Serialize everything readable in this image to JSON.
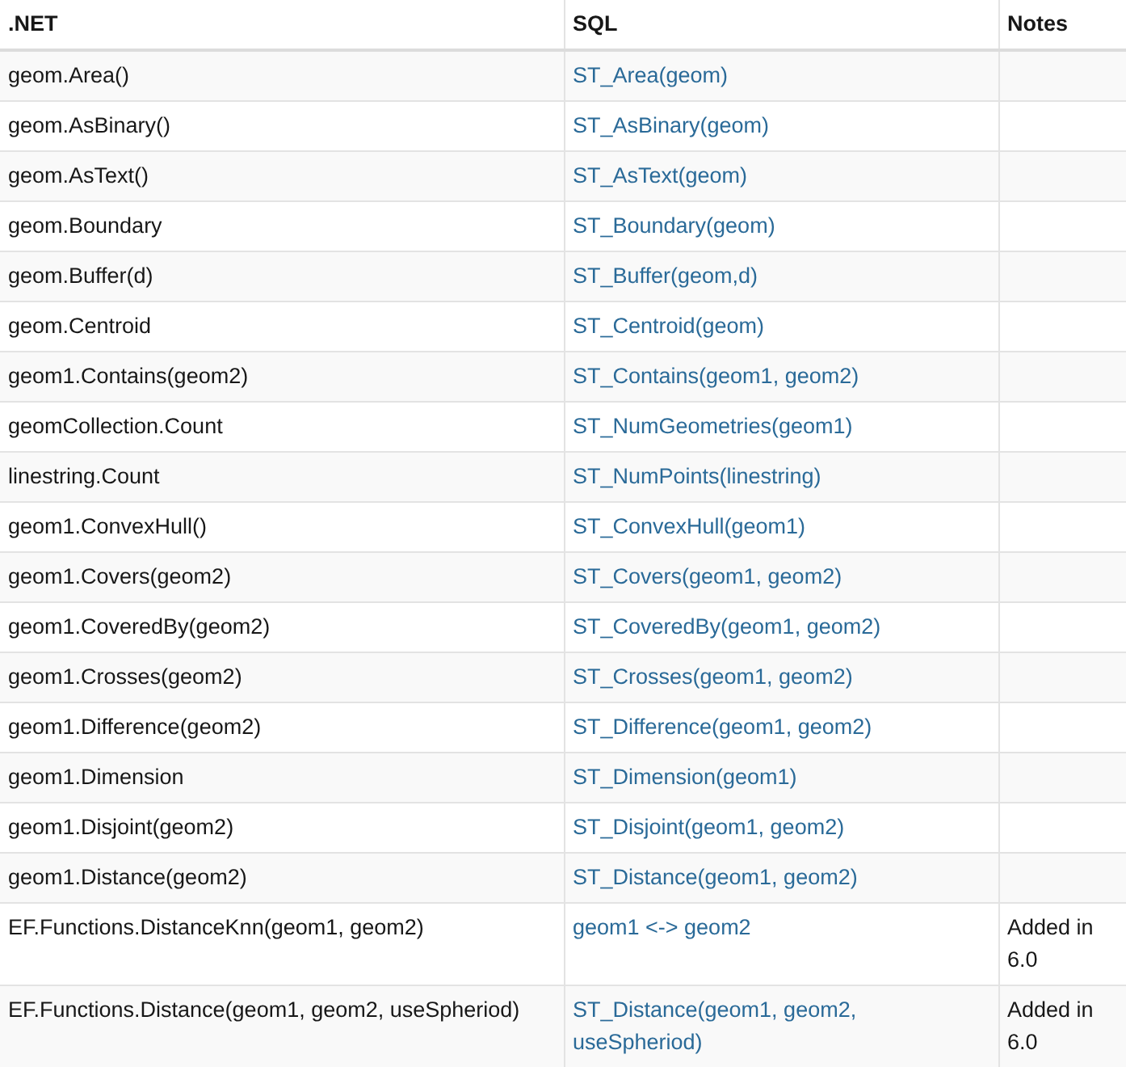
{
  "table": {
    "columns": [
      ".NET",
      "SQL",
      "Notes"
    ],
    "rows": [
      {
        "net": "geom.Area()",
        "sql": "ST_Area(geom)"
      },
      {
        "net": "geom.AsBinary()",
        "sql": "ST_AsBinary(geom)"
      },
      {
        "net": "geom.AsText()",
        "sql": "ST_AsText(geom)"
      },
      {
        "net": "geom.Boundary",
        "sql": "ST_Boundary(geom)"
      },
      {
        "net": "geom.Buffer(d)",
        "sql": "ST_Buffer(geom,d)"
      },
      {
        "net": "geom.Centroid",
        "sql": "ST_Centroid(geom)"
      },
      {
        "net": "geom1.Contains(geom2)",
        "sql": "ST_Contains(geom1, geom2)"
      },
      {
        "net": "geomCollection.Count",
        "sql": "ST_NumGeometries(geom1)"
      },
      {
        "net": "linestring.Count",
        "sql": "ST_NumPoints(linestring)"
      },
      {
        "net": "geom1.ConvexHull()",
        "sql": "ST_ConvexHull(geom1)"
      },
      {
        "net": "geom1.Covers(geom2)",
        "sql": "ST_Covers(geom1, geom2)"
      },
      {
        "net": "geom1.CoveredBy(geom2)",
        "sql": "ST_CoveredBy(geom1, geom2)"
      },
      {
        "net": "geom1.Crosses(geom2)",
        "sql": "ST_Crosses(geom1, geom2)"
      },
      {
        "net": "geom1.Difference(geom2)",
        "sql": "ST_Difference(geom1, geom2)"
      },
      {
        "net": "geom1.Dimension",
        "sql": "ST_Dimension(geom1)"
      },
      {
        "net": "geom1.Disjoint(geom2)",
        "sql": "ST_Disjoint(geom1, geom2)"
      },
      {
        "net": "geom1.Distance(geom2)",
        "sql": "ST_Distance(geom1, geom2)"
      },
      {
        "net": "EF.Functions.DistanceKnn(geom1, geom2)",
        "sql": "geom1 <-> geom2",
        "notes": "Added in 6.0"
      },
      {
        "net": "EF.Functions.Distance(geom1, geom2, useSpheriod)",
        "sql": "ST_Distance(geom1, geom2, useSpheriod)",
        "notes": "Added in 6.0"
      }
    ]
  }
}
